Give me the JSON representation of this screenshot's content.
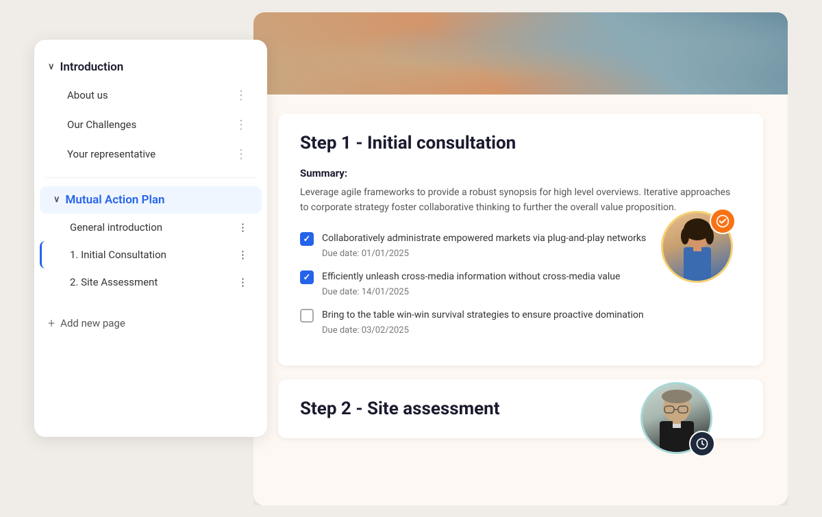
{
  "sidebar": {
    "introduction_label": "Introduction",
    "introduction_expanded": true,
    "items_introduction": [
      {
        "label": "About us",
        "id": "about-us"
      },
      {
        "label": "Our Challenges",
        "id": "our-challenges"
      },
      {
        "label": "Your representative",
        "id": "your-representative"
      }
    ],
    "mutual_action_plan_label": "Mutual Action Plan",
    "mutual_action_plan_expanded": true,
    "items_map": [
      {
        "label": "General introduction",
        "id": "general-introduction",
        "active": false
      },
      {
        "label": "1. Initial Consultation",
        "id": "initial-consultation",
        "active": true
      },
      {
        "label": "2. Site Assessment",
        "id": "site-assessment",
        "active": false
      }
    ],
    "add_page_label": "Add new page"
  },
  "main": {
    "step1": {
      "title": "Step 1 - Initial consultation",
      "summary_label": "Summary:",
      "summary_text": "Leverage agile frameworks to provide a robust synopsis for high level overviews. Iterative approaches to corporate strategy foster collaborative thinking to further the overall value proposition.",
      "tasks": [
        {
          "text": "Collaboratively administrate empowered markets via plug-and-play networks",
          "due_date": "Due date: 01/01/2025",
          "checked": true
        },
        {
          "text": "Efficiently unleash cross-media information without cross-media value",
          "due_date": "Due date: 14/01/2025",
          "checked": true
        },
        {
          "text": "Bring to the table win-win survival strategies to ensure proactive domination",
          "due_date": "Due date: 03/02/2025",
          "checked": false
        }
      ]
    },
    "step2": {
      "title": "Step 2 - Site assessment"
    }
  },
  "icons": {
    "chevron_down": "∨",
    "dots": "⋮",
    "plus": "+",
    "check": "✓",
    "clock": "🕐"
  }
}
